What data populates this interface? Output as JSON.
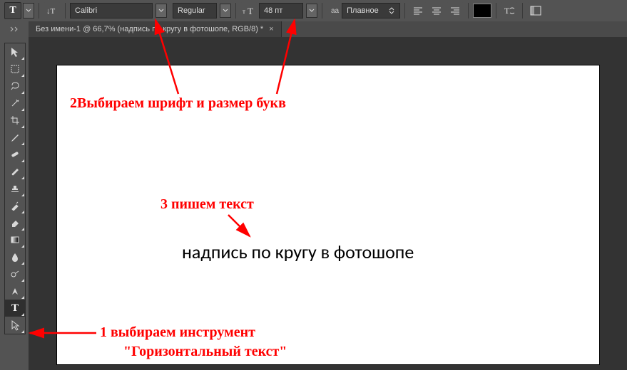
{
  "options": {
    "tool_letter": "T",
    "font_family": "Calibri",
    "font_style": "Regular",
    "font_size": "48 пт",
    "aa_small": "aа",
    "aa_mode": "Плавное"
  },
  "tab": {
    "title": "Без имени-1 @ 66,7% (надпись по кругу в фотошопе, RGB/8) *",
    "close": "×"
  },
  "canvas": {
    "text": "надпись по кругу в фотошопе"
  },
  "anno": {
    "a1": "1 выбираем инструмент",
    "a1b": "\"Горизонтальный текст\"",
    "a2": "2Выбираем шрифт и размер букв",
    "a3": "3 пишем текст"
  }
}
